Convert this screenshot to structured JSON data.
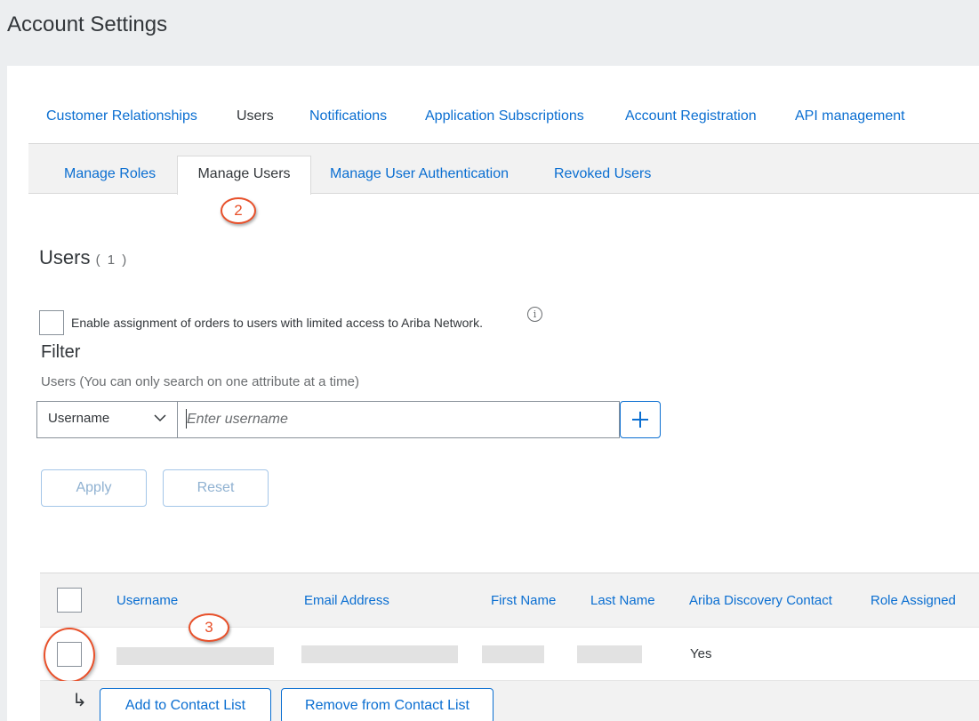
{
  "page": {
    "title": "Account Settings"
  },
  "top_tabs": [
    {
      "label": "Customer Relationships",
      "active": false
    },
    {
      "label": "Users",
      "active": true
    },
    {
      "label": "Notifications",
      "active": false
    },
    {
      "label": "Application Subscriptions",
      "active": false
    },
    {
      "label": "Account Registration",
      "active": false
    },
    {
      "label": "API management",
      "active": false
    }
  ],
  "sub_tabs": [
    {
      "label": "Manage Roles",
      "active": false
    },
    {
      "label": "Manage Users",
      "active": true
    },
    {
      "label": "Manage User Authentication",
      "active": false
    },
    {
      "label": "Revoked Users",
      "active": false
    }
  ],
  "callouts": {
    "step2": "2",
    "step3": "3"
  },
  "users_section": {
    "heading": "Users",
    "count": "( 1 )"
  },
  "limited_access": {
    "label": "Enable assignment of orders to users with limited access to Ariba Network.",
    "checked": false,
    "info_icon": "info-icon"
  },
  "filter": {
    "heading": "Filter",
    "hint": "Users (You can only search on one attribute at a time)",
    "attribute_selected": "Username",
    "input_placeholder": "Enter username",
    "input_value": "",
    "apply_label": "Apply",
    "reset_label": "Reset"
  },
  "table": {
    "columns": [
      "Username",
      "Email Address",
      "First Name",
      "Last Name",
      "Ariba Discovery Contact",
      "Role Assigned"
    ],
    "rows": [
      {
        "username": "",
        "email": "",
        "first_name": "",
        "last_name": "",
        "discovery_contact": "Yes",
        "role_assigned": ""
      }
    ]
  },
  "actions": {
    "add_contact": "Add to Contact List",
    "remove_contact": "Remove from Contact List"
  },
  "colors": {
    "link": "#0a6ed1",
    "text": "#32363a",
    "callout": "#e8502a",
    "page_bg": "#eceef0"
  }
}
